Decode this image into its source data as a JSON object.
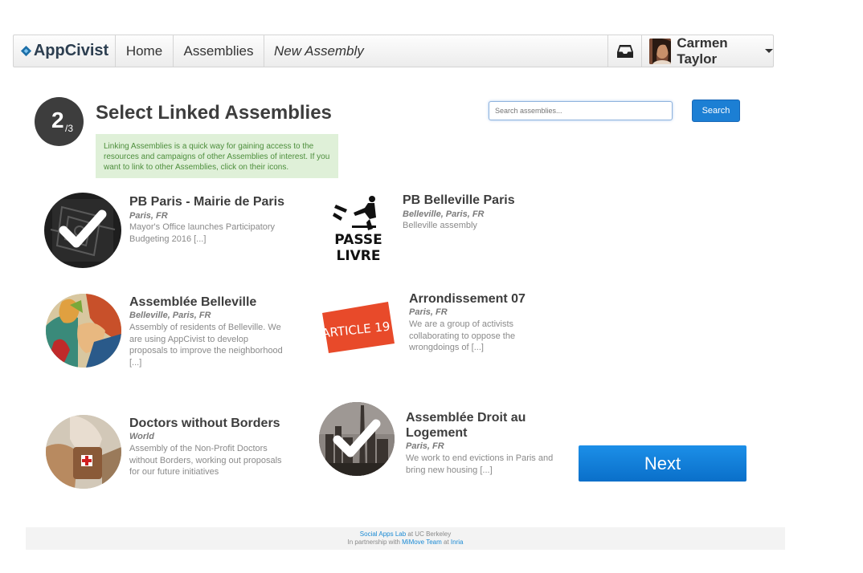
{
  "navbar": {
    "brand": "AppCivist",
    "home": "Home",
    "assemblies": "Assemblies",
    "current": "New Assembly",
    "user_name": "Carmen Taylor"
  },
  "step": {
    "number": "2",
    "total": "/3"
  },
  "title": "Select Linked Assemblies",
  "info": "Linking Assemblies is a quick way for gaining access to the resources and campaigns of other Assemblies of interest. If you want to link to other Assemblies, click on their icons.",
  "search": {
    "placeholder": "Search assemblies...",
    "button": "Search"
  },
  "assemblies": [
    {
      "title": "PB Paris - Mairie de Paris",
      "location": "Paris, FR",
      "description": "Mayor's Office launches Participatory Budgeting 2016 [...]",
      "selected": true
    },
    {
      "title": "PB Belleville Paris",
      "location": "Belleville, Paris, FR",
      "description": "Belleville assembly",
      "selected": false,
      "logo_text": [
        "PASSE",
        "LIVRE"
      ]
    },
    {
      "title": "Assemblée Belleville",
      "location": "Belleville, Paris, FR",
      "description": "Assembly of residents of Belleville. We are using AppCivist to develop proposals to improve the neighborhood [...]",
      "selected": false
    },
    {
      "title": "Arrondissement 07",
      "location": "Paris, FR",
      "description": "We are a group of activists collaborating to oppose the wrongdoings of [...]",
      "selected": false,
      "logo_text": "ARTICLE 19"
    },
    {
      "title": "Doctors without Borders",
      "location": "World",
      "description": "Assembly of the Non-Profit Doctors without Borders, working out proposals for our future initiatives",
      "selected": false
    },
    {
      "title": "Assemblée Droit au Logement",
      "location": "Paris, FR",
      "description": "We work to end evictions in Paris and bring new housing [...]",
      "selected": true
    }
  ],
  "next_button": "Next",
  "footer": {
    "lab": "Social Apps Lab",
    "at_ucb": " at UC Berkeley",
    "partnership": "In partnership with ",
    "team": "MiMove Team",
    "at": " at ",
    "inria": "Inria"
  },
  "colors": {
    "primary": "#1c7fd4",
    "info_bg": "#dff0d8",
    "info_text": "#4d8e3c"
  }
}
